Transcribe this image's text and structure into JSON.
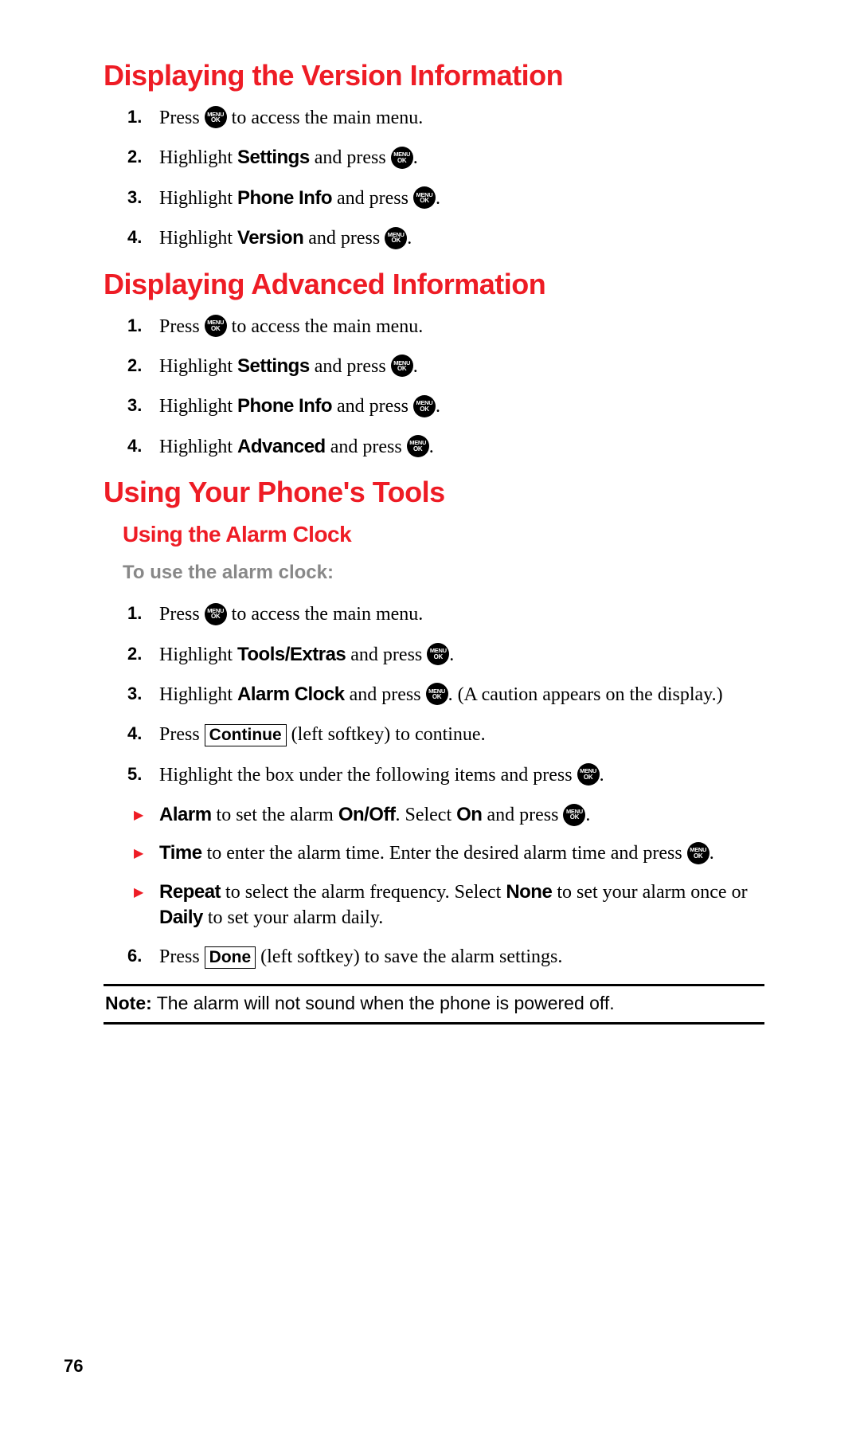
{
  "icon": {
    "menu": "MENU",
    "ok": "OK"
  },
  "page_number": "76",
  "section1": {
    "title": "Displaying the Version Information",
    "steps": [
      {
        "pre": "Press ",
        "post": " to access the main menu."
      },
      {
        "pre": "Highlight ",
        "b1": "Settings",
        "mid": " and press ",
        "post": "."
      },
      {
        "pre": "Highlight ",
        "b1": "Phone Info",
        "mid": " and press ",
        "post": "."
      },
      {
        "pre": "Highlight ",
        "b1": "Version",
        "mid": " and press ",
        "post": "."
      }
    ]
  },
  "section2": {
    "title": "Displaying Advanced Information",
    "steps": [
      {
        "pre": "Press ",
        "post": " to access the main menu."
      },
      {
        "pre": "Highlight ",
        "b1": "Settings",
        "mid": " and press ",
        "post": "."
      },
      {
        "pre": "Highlight ",
        "b1": "Phone Info",
        "mid": " and press ",
        "post": "."
      },
      {
        "pre": "Highlight ",
        "b1": "Advanced",
        "mid": " and press ",
        "post": "."
      }
    ]
  },
  "section3": {
    "title": "Using Your Phone's Tools",
    "sub": {
      "title": "Using the Alarm Clock",
      "intro": "To use the alarm clock:",
      "steps": {
        "s1": {
          "pre": "Press ",
          "post": " to access the main menu."
        },
        "s2": {
          "pre": "Highlight ",
          "b1": "Tools/Extras",
          "mid": " and press ",
          "post": "."
        },
        "s3": {
          "pre": "Highlight ",
          "b1": "Alarm Clock",
          "mid": " and press ",
          "post": ". (A caution appears on the display.)"
        },
        "s4": {
          "pre": "Press ",
          "key": "Continue",
          "post": " (left softkey) to continue."
        },
        "s5": {
          "pre": "Highlight the box under the following items and press ",
          "post": "."
        },
        "s6": {
          "pre": "Press ",
          "key": "Done",
          "post": " (left softkey) to save the alarm settings."
        }
      },
      "bullets": {
        "b1": {
          "t1": "Alarm",
          "t2": " to set the alarm ",
          "t3": "On/Off",
          "t4": ". Select ",
          "t5": "On",
          "t6": " and press ",
          "t7": "."
        },
        "b2": {
          "t1": "Time",
          "t2": " to enter the alarm time. Enter the desired alarm time and press ",
          "t3": "."
        },
        "b3": {
          "t1": "Repeat",
          "t2": " to select the alarm frequency. Select ",
          "t3": "None",
          "t4": " to set your alarm once or ",
          "t5": "Daily",
          "t6": " to set your alarm daily."
        }
      }
    }
  },
  "note": {
    "label": "Note:",
    "text": " The alarm will not sound when the phone is powered off."
  }
}
